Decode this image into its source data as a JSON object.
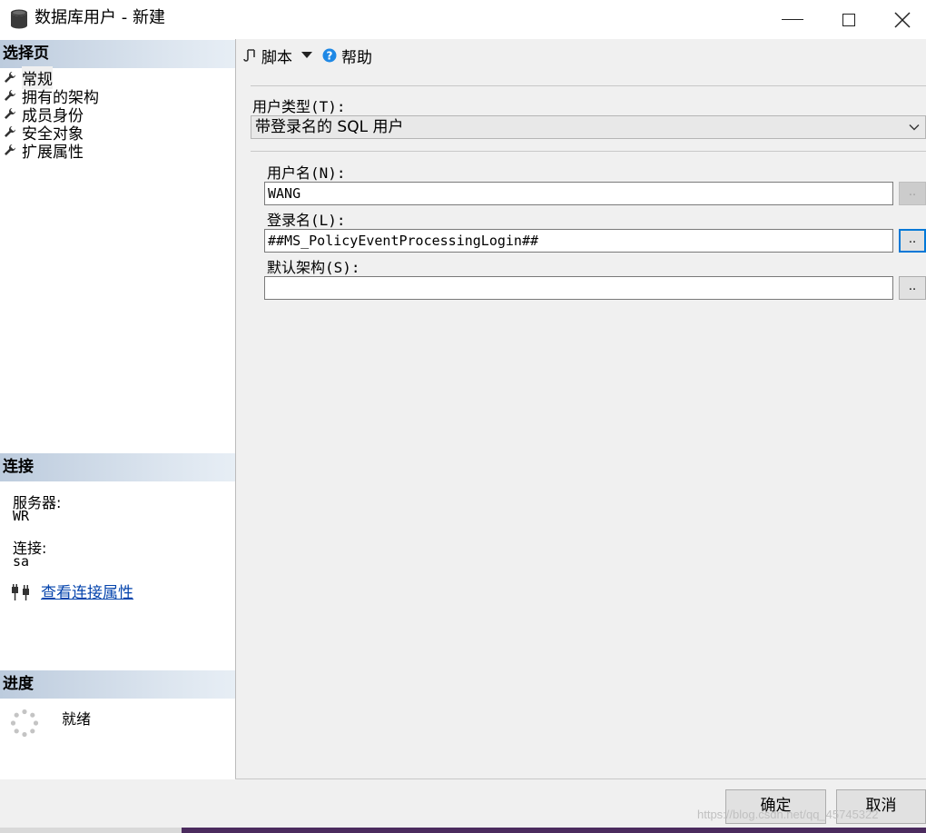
{
  "window": {
    "title": "数据库用户 - 新建",
    "minimize_glyph": "—",
    "close_glyph": "✕"
  },
  "left": {
    "select_page_header": "选择页",
    "nav_items": [
      {
        "label": "常规",
        "icon": "wrench-icon",
        "selected": true
      },
      {
        "label": "拥有的架构",
        "icon": "wrench-icon"
      },
      {
        "label": "成员身份",
        "icon": "wrench-icon"
      },
      {
        "label": "安全对象",
        "icon": "wrench-icon"
      },
      {
        "label": "扩展属性",
        "icon": "wrench-icon"
      }
    ],
    "connection_header": "连接",
    "server_label": "服务器:",
    "server_value": "WR",
    "connection_label": "连接:",
    "connection_value": "sa",
    "view_connection_link": "查看连接属性",
    "progress_header": "进度",
    "progress_status": "就绪"
  },
  "toolbar": {
    "script_label": "脚本",
    "help_label": "帮助"
  },
  "form": {
    "user_type_label": "用户类型(T):",
    "user_type_value": "带登录名的 SQL 用户",
    "user_name_label": "用户名(N):",
    "user_name_value": "WANG",
    "login_name_label": "登录名(L):",
    "login_name_value": "##MS_PolicyEventProcessingLogin##",
    "default_schema_label": "默认架构(S):",
    "default_schema_value": "",
    "ellipsis_label": ".."
  },
  "buttons": {
    "ok_label": "确定",
    "cancel_label": "取消"
  },
  "watermark": "https://blog.csdn.net/qq_45745322",
  "colors": {
    "header_gradient_start": "#bccbdd",
    "link": "#0645ad",
    "help_icon": "#1e88e5",
    "focus_border": "#0078d7",
    "taskbar": "#4b2b5e"
  }
}
